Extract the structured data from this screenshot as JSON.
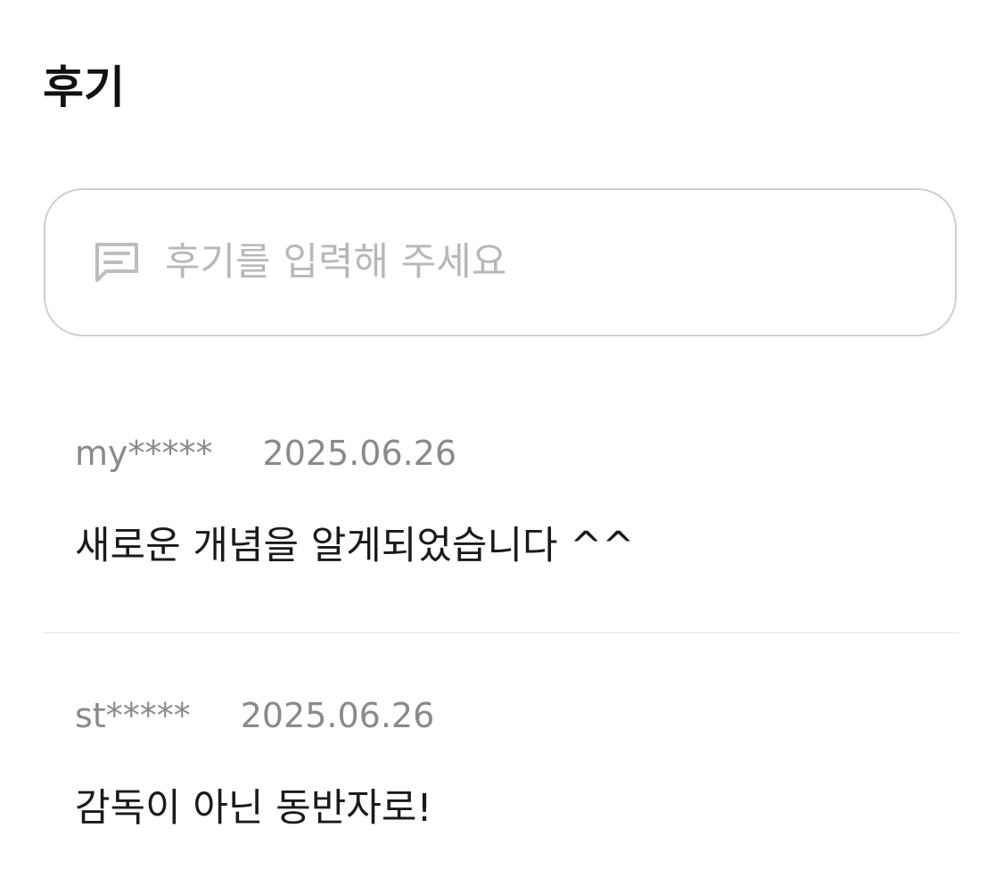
{
  "section": {
    "title": "후기"
  },
  "review_input": {
    "icon": "comment-icon",
    "placeholder": "후기를 입력해 주세요"
  },
  "reviews": [
    {
      "author": "my*****",
      "date": "2025.06.26",
      "text": "새로운 개념을 알게되었습니다 ^^"
    },
    {
      "author": "st*****",
      "date": "2025.06.26",
      "text": "감독이 아닌 동반자로!"
    }
  ],
  "colors": {
    "title": "#111111",
    "placeholder": "#b8b8b8",
    "meta": "#8a8a8a",
    "input_border": "#cfcfcf",
    "divider": "#efefef"
  }
}
